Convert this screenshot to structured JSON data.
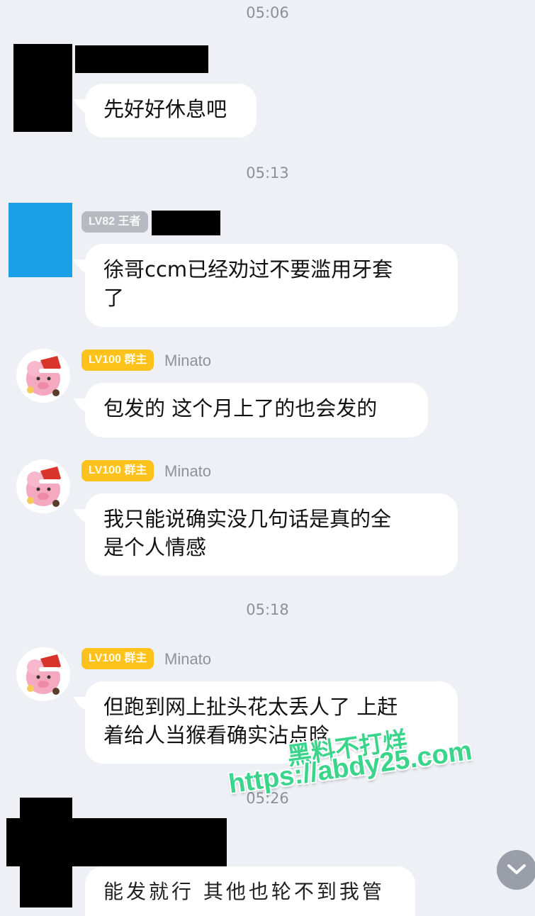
{
  "times": [
    "05:06",
    "05:13",
    "05:18",
    "05:26"
  ],
  "messages": [
    {
      "text": "先好好休息吧"
    },
    {
      "badge": "LV82 王者",
      "text": "徐哥ccm已经劝过不要滥用牙套",
      "text2": "了"
    },
    {
      "badge": "LV100 群主",
      "name": "Minato",
      "text": "包发的 这个月上了的也会发的"
    },
    {
      "badge": "LV100 群主",
      "name": "Minato",
      "text": "我只能说确实没几句话是真的全",
      "text2": "是个人情感"
    },
    {
      "badge": "LV100 群主",
      "name": "Minato",
      "text": "但跑到网上扯头花太丢人了 上赶",
      "text2": "着给人当猴看确实沾点晗"
    },
    {
      "text": "能发就行 其他也轮不到我管"
    }
  ],
  "watermark": {
    "line1": "黑料不打烊",
    "line2": "https://abdy25.com"
  },
  "colors": {
    "badge_gold": "#ffc21a",
    "badge_gray": "#b7bac0",
    "avatar_blue": "#1aa0e8",
    "background": "#eef0f5"
  },
  "icons": {
    "scroll_down": "chevron-down-icon",
    "avatar": "pig-santa-avatar"
  }
}
